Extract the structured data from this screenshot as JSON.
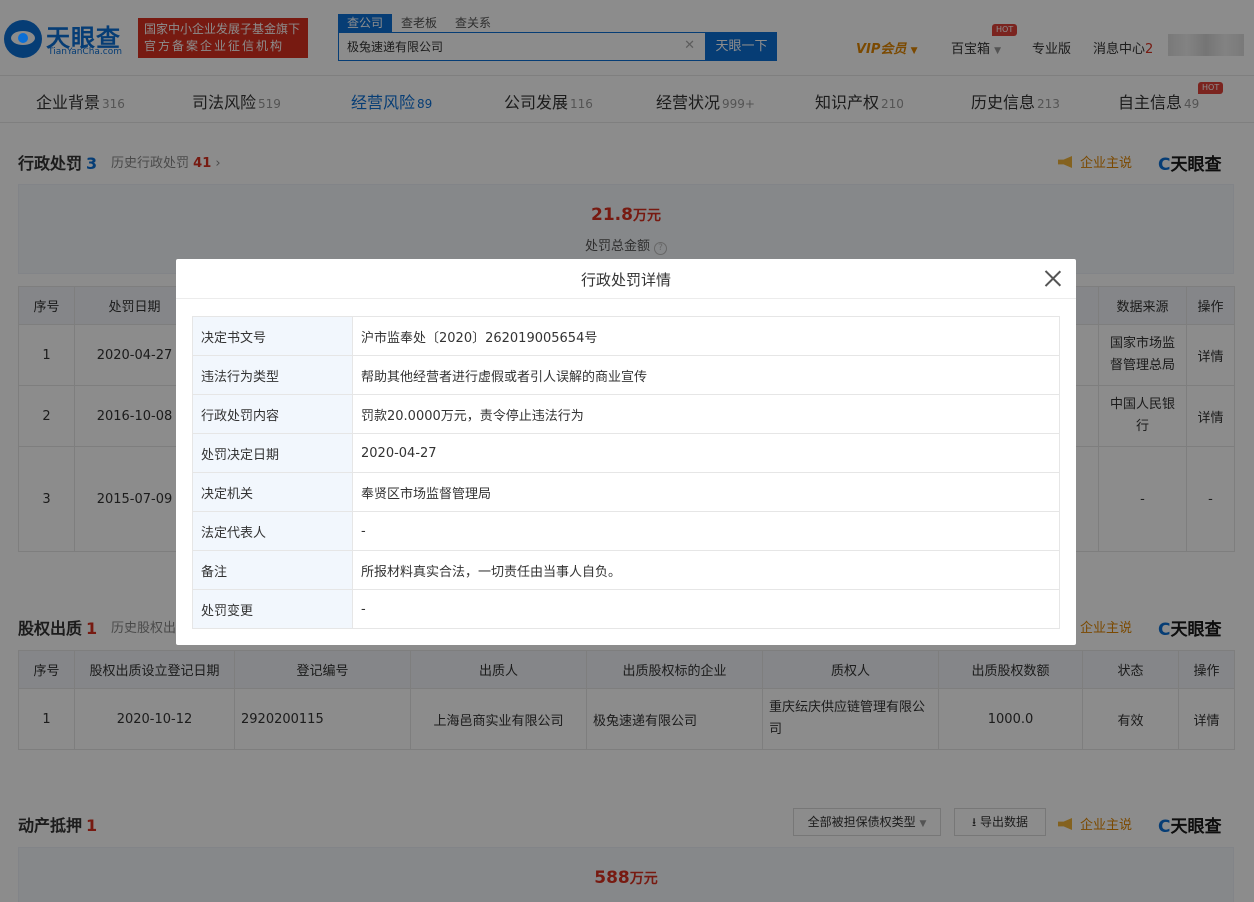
{
  "header": {
    "logo_text": "天眼查",
    "logo_sub": "TianYanCha.com",
    "fund_line1": "国家中小企业发展子基金旗下",
    "fund_line2": "官方备案企业征信机构",
    "search_tabs": [
      "查公司",
      "查老板",
      "查关系"
    ],
    "search_value": "极兔速递有限公司",
    "search_button": "天眼一下",
    "vip": "VIP会员",
    "baibaoxiang": "百宝箱",
    "hot": "HOT",
    "pro": "专业版",
    "message_center": "消息中心",
    "message_count": "2"
  },
  "categories": [
    {
      "label": "企业背景",
      "count": "316"
    },
    {
      "label": "司法风险",
      "count": "519"
    },
    {
      "label": "经营风险",
      "count": "89"
    },
    {
      "label": "公司发展",
      "count": "116"
    },
    {
      "label": "经营状况",
      "count": "999+"
    },
    {
      "label": "知识产权",
      "count": "210"
    },
    {
      "label": "历史信息",
      "count": "213"
    },
    {
      "label": "自主信息",
      "count": "49"
    }
  ],
  "penalty": {
    "title": "行政处罚",
    "count": "3",
    "history_label": "历史行政处罚",
    "history_count": "41",
    "owner_talk": "企业主说",
    "brand": "天眼查",
    "total_amount": "21.8",
    "total_unit": "万元",
    "total_label": "处罚总金额",
    "headers": [
      "序号",
      "处罚日期",
      "数据来源",
      "操作"
    ],
    "rows": [
      {
        "no": "1",
        "date": "2020-04-27",
        "source": "国家市场监督管理总局",
        "op": "详情"
      },
      {
        "no": "2",
        "date": "2016-10-08",
        "source": "中国人民银行",
        "op": "详情"
      },
      {
        "no": "3",
        "date": "2015-07-09",
        "source": "-",
        "op": "-"
      }
    ]
  },
  "pledge": {
    "title": "股权出质",
    "count": "1",
    "history_label": "历史股权出质",
    "owner_talk": "企业主说",
    "brand": "天眼查",
    "headers": [
      "序号",
      "股权出质设立登记日期",
      "登记编号",
      "出质人",
      "出质股权标的企业",
      "质权人",
      "出质股权数额",
      "状态",
      "操作"
    ],
    "rows": [
      {
        "no": "1",
        "date": "2020-10-12",
        "reg_no": "2920200115",
        "pledgor": "上海邑商实业有限公司",
        "target": "极兔速递有限公司",
        "pledgee": "重庆纭庆供应链管理有限公司",
        "amount": "1000.0",
        "status": "有效",
        "op": "详情"
      }
    ]
  },
  "chattel": {
    "title": "动产抵押",
    "count": "1",
    "filter_label": "全部被担保债权类型",
    "export_label": "导出数据",
    "owner_talk": "企业主说",
    "brand": "天眼查",
    "amount": "588",
    "unit": "万元"
  },
  "modal": {
    "title": "行政处罚详情",
    "rows": [
      {
        "k": "决定书文号",
        "v": "沪市监奉处〔2020〕262019005654号"
      },
      {
        "k": "违法行为类型",
        "v": "帮助其他经营者进行虚假或者引人误解的商业宣传"
      },
      {
        "k": "行政处罚内容",
        "v": "罚款20.0000万元，责令停止违法行为"
      },
      {
        "k": "处罚决定日期",
        "v": "2020-04-27"
      },
      {
        "k": "决定机关",
        "v": "奉贤区市场监督管理局"
      },
      {
        "k": "法定代表人",
        "v": "-"
      },
      {
        "k": "备注",
        "v": "所报材料真实合法，一切责任由当事人自负。"
      },
      {
        "k": "处罚变更",
        "v": "-"
      }
    ]
  },
  "colors": {
    "brand_blue": "#0b6fd6",
    "alert_red": "#d9301f",
    "vip_orange": "#e08600",
    "ok_green": "#2e9a3d"
  }
}
